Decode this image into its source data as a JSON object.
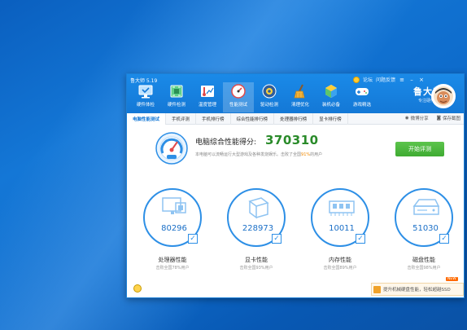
{
  "app": {
    "title": "鲁大师 5.19",
    "brand_name": "鲁大师",
    "brand_slogan": "专注硬件防护"
  },
  "top_links": {
    "forum": "论坛",
    "feedback": "问题反馈"
  },
  "nav": {
    "items": [
      {
        "label": "硬件体检",
        "icon": "monitor-check-icon"
      },
      {
        "label": "硬件检测",
        "icon": "chip-board-icon"
      },
      {
        "label": "温度管理",
        "icon": "thermometer-chart-icon"
      },
      {
        "label": "性能测试",
        "icon": "speedometer-icon"
      },
      {
        "label": "驱动检测",
        "icon": "driver-gear-icon"
      },
      {
        "label": "清理优化",
        "icon": "broom-icon"
      },
      {
        "label": "装机必备",
        "icon": "apps-cube-icon"
      },
      {
        "label": "游戏精选",
        "icon": "gamepad-icon"
      }
    ],
    "active_index": 3
  },
  "subtabs": {
    "items": [
      "电脑性能测试",
      "手机评测",
      "手机排行榜",
      "综合性能排行榜",
      "处理器排行榜",
      "显卡排行榜"
    ],
    "active_index": 0,
    "weibo_share": "微博分享",
    "save_screenshot": "保存截图"
  },
  "score": {
    "label": "电脑综合性能得分:",
    "value": "370310",
    "desc_prefix": "本电脑可以流畅运行大型游戏及各种发烧娱乐。击败了全国",
    "percent": "91%",
    "desc_suffix": "的用户",
    "start_button": "开始评测"
  },
  "metrics": [
    {
      "name": "处理器性能",
      "value": "80296",
      "sub": "击败全国78%用户",
      "icon": "cpu-icon"
    },
    {
      "name": "显卡性能",
      "value": "228973",
      "sub": "击败全国93%用户",
      "icon": "gpu-cube-icon"
    },
    {
      "name": "内存性能",
      "value": "10011",
      "sub": "击败全国89%用户",
      "icon": "memory-stick-icon"
    },
    {
      "name": "磁盘性能",
      "value": "51030",
      "sub": "击败全国98%用户",
      "icon": "disk-icon"
    }
  ],
  "promo": {
    "text": "提升机械硬盘性能，轻松超越SSD",
    "badge": "NEW"
  },
  "colors": {
    "primary_blue": "#1478d6",
    "score_green": "#2a8b2a",
    "button_green": "#3fab32",
    "highlight_orange": "#f08a00"
  }
}
